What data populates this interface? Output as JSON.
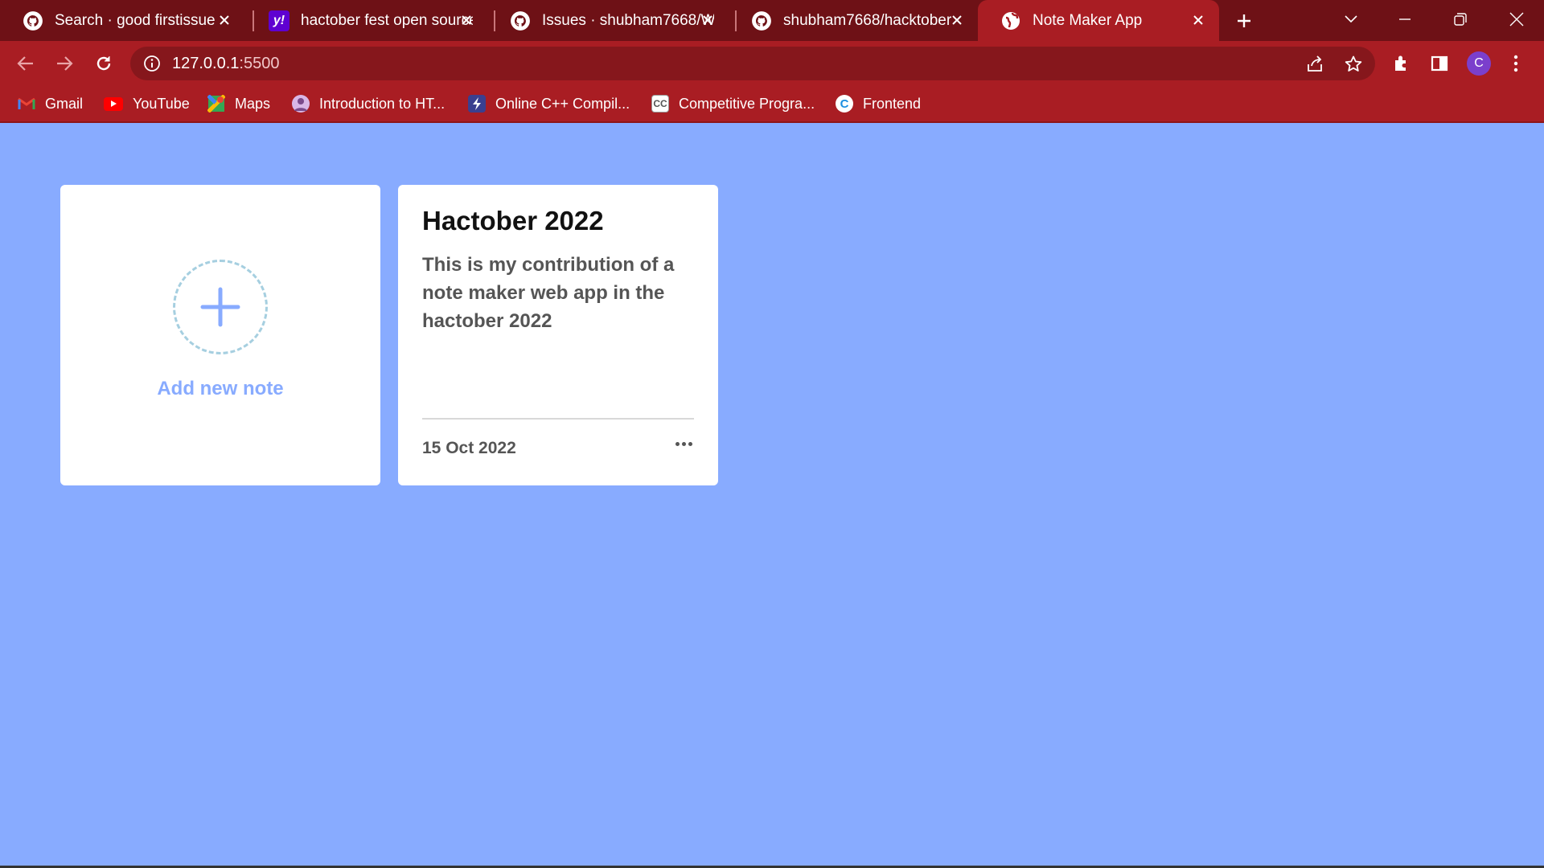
{
  "browser": {
    "tabs": [
      {
        "title": "Search · good firstissue",
        "icon": "github-icon",
        "active": false
      },
      {
        "title": "hactober fest open source",
        "icon": "yahoo-icon",
        "active": false
      },
      {
        "title": "Issues · shubham7668/We",
        "icon": "github-icon",
        "active": false
      },
      {
        "title": "shubham7668/hacktober",
        "icon": "github-icon",
        "active": false
      },
      {
        "title": "Note Maker App",
        "icon": "globe-icon",
        "active": true
      }
    ],
    "address": {
      "host": "127.0.0.1",
      "port": ":5500"
    },
    "profile_initial": "C",
    "bookmarks": [
      {
        "label": "Gmail",
        "icon": "gmail-icon"
      },
      {
        "label": "YouTube",
        "icon": "youtube-icon"
      },
      {
        "label": "Maps",
        "icon": "maps-icon"
      },
      {
        "label": "Introduction to HT...",
        "icon": "avatar-icon"
      },
      {
        "label": "Online C++ Compil...",
        "icon": "lightning-icon"
      },
      {
        "label": "Competitive Progra...",
        "icon": "cc-icon"
      },
      {
        "label": "Frontend",
        "icon": "c-logo-icon"
      }
    ],
    "colors": {
      "tabbar": "#6e1116",
      "toolbar": "#a91d23",
      "omnibox": "#86171c"
    }
  },
  "app": {
    "background": "#88abff",
    "add_note": {
      "label": "Add new note"
    },
    "notes": [
      {
        "title": "Hactober 2022",
        "body": "This is my contribution of a note maker web app in the hactober 2022",
        "date": "15 Oct 2022"
      }
    ]
  }
}
